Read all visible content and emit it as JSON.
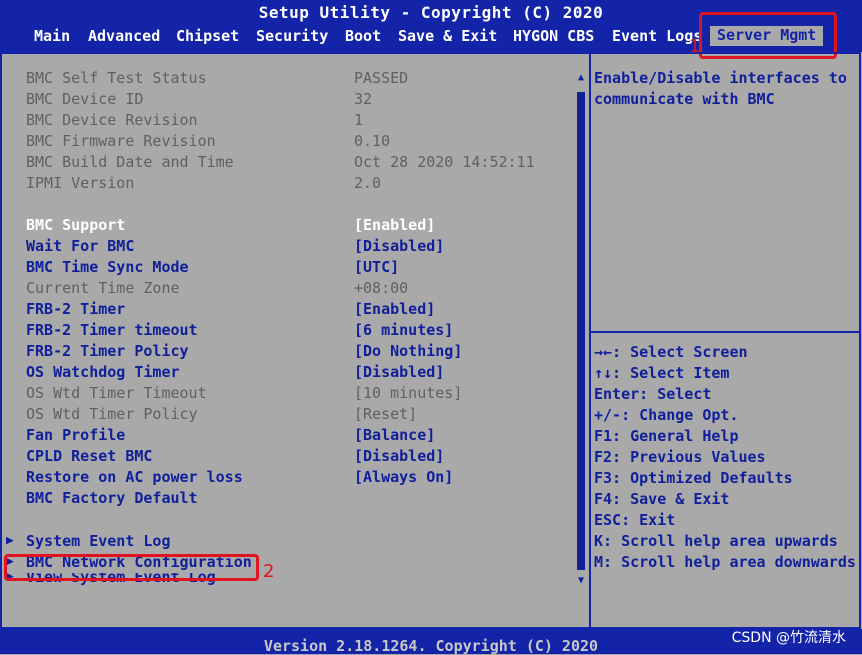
{
  "header": {
    "title": "Setup Utility - Copyright (C) 2020",
    "tabs": [
      "Main",
      "Advanced",
      "Chipset",
      "Security",
      "Boot",
      "Save & Exit",
      "HYGON CBS",
      "Event Logs",
      "Server Mgmt"
    ],
    "active_tab": "Server Mgmt"
  },
  "info": [
    {
      "label": "BMC Self Test Status",
      "value": "PASSED"
    },
    {
      "label": "BMC Device ID",
      "value": "32"
    },
    {
      "label": "BMC Device Revision",
      "value": "1"
    },
    {
      "label": "BMC Firmware Revision",
      "value": "0.10"
    },
    {
      "label": "BMC Build Date and Time",
      "value": "Oct 28 2020 14:52:11"
    },
    {
      "label": "IPMI Version",
      "value": "2.0"
    }
  ],
  "settings": [
    {
      "label": "BMC Support",
      "value": "[Enabled]",
      "state": "selected"
    },
    {
      "label": "Wait For BMC",
      "value": "[Disabled]",
      "state": "editable"
    },
    {
      "label": "BMC Time Sync Mode",
      "value": "[UTC]",
      "state": "editable"
    },
    {
      "label": "Current Time Zone",
      "value": "+08:00",
      "state": "readonly"
    },
    {
      "label": "FRB-2 Timer",
      "value": "[Enabled]",
      "state": "editable"
    },
    {
      "label": "FRB-2 Timer timeout",
      "value": "[6 minutes]",
      "state": "editable"
    },
    {
      "label": "FRB-2 Timer Policy",
      "value": "[Do Nothing]",
      "state": "editable"
    },
    {
      "label": "OS Watchdog Timer",
      "value": "[Disabled]",
      "state": "editable"
    },
    {
      "label": "OS Wtd Timer Timeout",
      "value": "[10 minutes]",
      "state": "readonly"
    },
    {
      "label": "OS Wtd Timer Policy",
      "value": "[Reset]",
      "state": "readonly"
    },
    {
      "label": "Fan Profile",
      "value": "[Balance]",
      "state": "editable"
    },
    {
      "label": "CPLD Reset BMC",
      "value": "[Disabled]",
      "state": "editable"
    },
    {
      "label": "Restore on AC power loss",
      "value": "[Always On]",
      "state": "editable"
    },
    {
      "label": "BMC Factory Default",
      "value": "",
      "state": "editable"
    }
  ],
  "submenus": [
    "System Event Log",
    "BMC Network Configuration",
    "View System Event Log"
  ],
  "help": {
    "description": "Enable/Disable interfaces to communicate with BMC",
    "keys": [
      "→←: Select Screen",
      "↑↓: Select Item",
      "Enter: Select",
      "+/-: Change Opt.",
      "F1: General Help",
      "F2: Previous Values",
      "F3: Optimized Defaults",
      "F4: Save & Exit",
      "ESC: Exit",
      "K: Scroll help area upwards",
      "M: Scroll help area downwards"
    ]
  },
  "footer": {
    "version": "Version 2.18.1264. Copyright (C) 2020"
  },
  "annotations": {
    "label_1": "1",
    "label_2": "2"
  },
  "watermark": "CSDN @竹流清水",
  "colors": {
    "header_blue": "#1424a8",
    "panel_grey": "#a9a9a9",
    "highlight_red": "#e0141e",
    "item_blue": "#10209a"
  }
}
